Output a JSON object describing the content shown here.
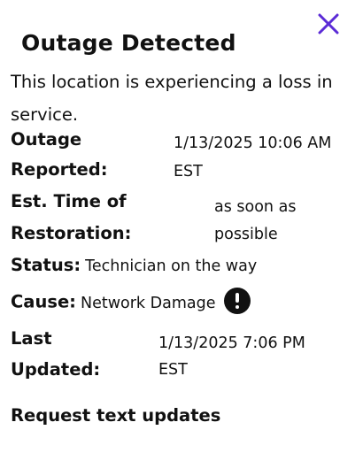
{
  "close": {
    "icon": "close-icon",
    "color": "#5b2bd6"
  },
  "title": "Outage Detected",
  "description": "This location is experiencing a loss in service.",
  "details": {
    "reported_label_1": "Outage",
    "reported_label_2": "Reported:",
    "reported_value_1": "1/13/2025 10:06 AM",
    "reported_value_2": "EST",
    "restoration_label_1": "Est. Time of",
    "restoration_label_2": "Restoration:",
    "restoration_value_1": "as soon as",
    "restoration_value_2": "possible",
    "status_label": "Status:",
    "status_value": "Technician on the way",
    "cause_label": "Cause:",
    "cause_value": "Network Damage",
    "cause_icon": "alert-icon",
    "updated_label_1": "Last",
    "updated_label_2": "Updated:",
    "updated_value_1": "1/13/2025 7:06 PM",
    "updated_value_2": "EST"
  },
  "request_link": "Request text updates"
}
